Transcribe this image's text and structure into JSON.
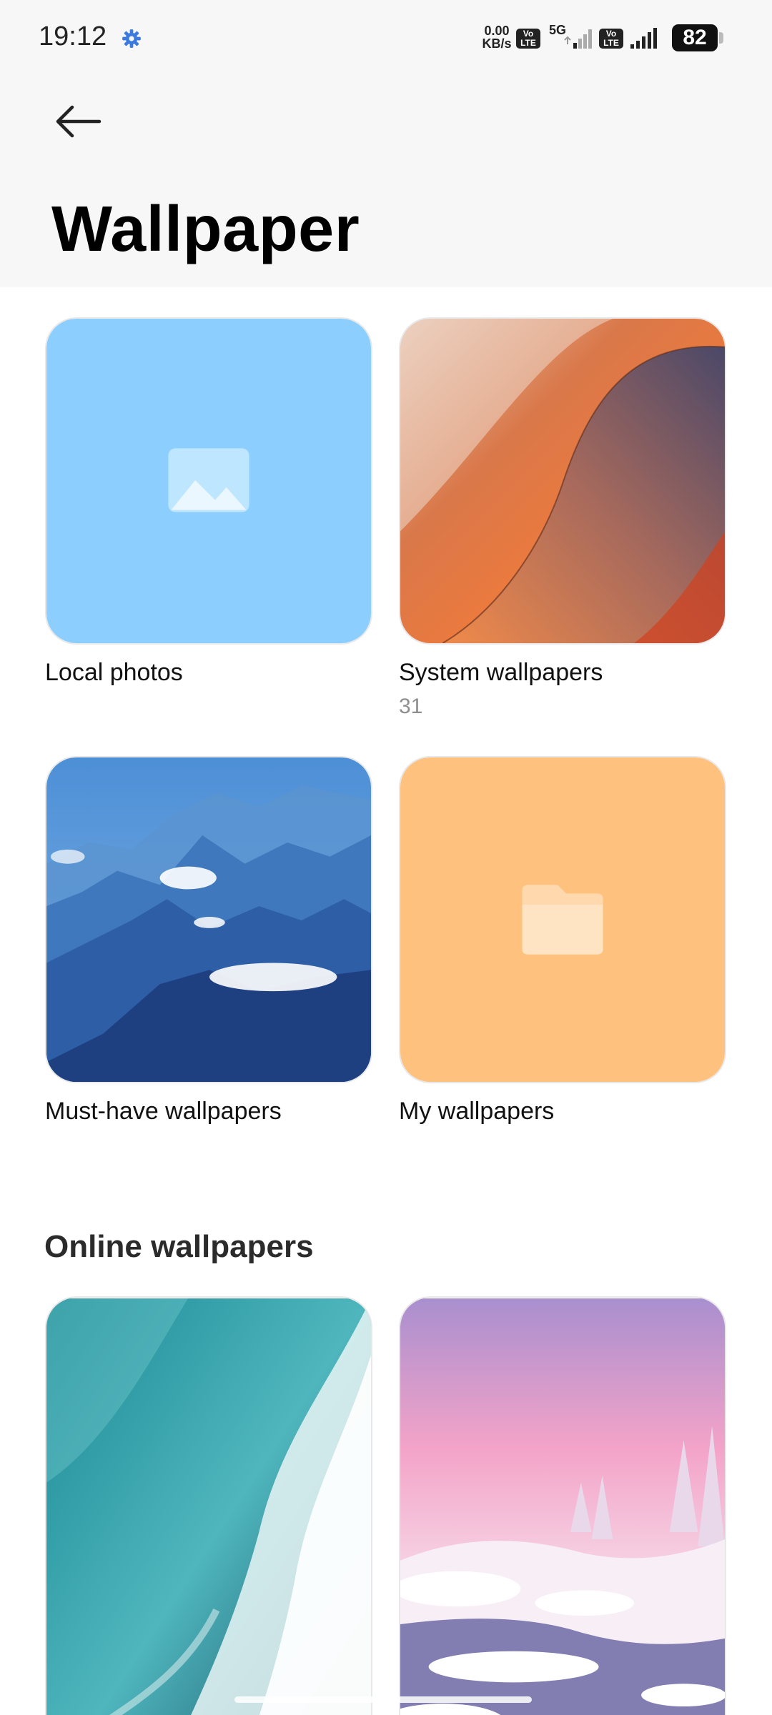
{
  "status_bar": {
    "time": "19:12",
    "net_speed_value": "0.00",
    "net_speed_unit": "KB/s",
    "volte_label": "Vo LTE",
    "network_type": "5G",
    "battery": "82"
  },
  "header": {
    "title": "Wallpaper"
  },
  "categories": [
    {
      "label": "Local photos",
      "count": ""
    },
    {
      "label": "System wallpapers",
      "count": "31"
    },
    {
      "label": "Must-have wallpapers",
      "count": ""
    },
    {
      "label": "My wallpapers",
      "count": ""
    }
  ],
  "online": {
    "title": "Online wallpapers"
  },
  "colors": {
    "local_photos_tile": "#8ccfff",
    "my_wallpapers_tile": "#ffc27e",
    "header_bg": "#f7f7f7"
  },
  "icons": [
    "back-arrow-icon",
    "settings-gear-icon",
    "image-placeholder-icon",
    "folder-icon"
  ]
}
